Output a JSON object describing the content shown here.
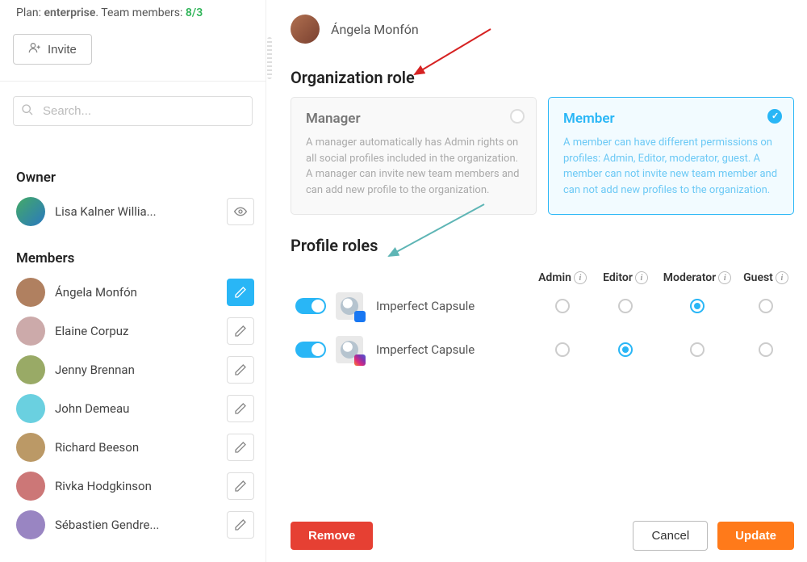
{
  "sidebar": {
    "plan_label": "Plan:",
    "plan_name": "enterprise",
    "members_label": "Team members:",
    "members_count": "8/3",
    "invite_label": "Invite",
    "search_placeholder": "Search...",
    "owner_label": "Owner",
    "members_label_section": "Members",
    "owner": {
      "name": "Lisa Kalner Willia..."
    },
    "members": [
      {
        "name": "Ángela Monfón",
        "editing": true
      },
      {
        "name": "Elaine Corpuz",
        "editing": false
      },
      {
        "name": "Jenny Brennan",
        "editing": false
      },
      {
        "name": "John Demeau",
        "editing": false
      },
      {
        "name": "Richard Beeson",
        "editing": false
      },
      {
        "name": "Rivka Hodgkinson",
        "editing": false
      },
      {
        "name": "Sébastien Gendre...",
        "editing": false
      }
    ]
  },
  "main": {
    "user_name": "Ángela Monfón",
    "org_role_title": "Organization role",
    "roles": {
      "manager": {
        "name": "Manager",
        "desc": "A manager automatically has Admin rights on all social profiles included in the organization. A manager can invite new team members and can add new profile to the organization."
      },
      "member": {
        "name": "Member",
        "desc": "A member can have different permissions on profiles: Admin, Editor, moderator, guest. A member can not invite new team member and can not add new profiles to the organization."
      }
    },
    "selected_role": "member",
    "profile_roles_title": "Profile roles",
    "columns": {
      "admin": "Admin",
      "editor": "Editor",
      "moderator": "Moderator",
      "guest": "Guest"
    },
    "profiles": [
      {
        "name": "Imperfect Capsule",
        "network": "facebook",
        "enabled": true,
        "role": "moderator"
      },
      {
        "name": "Imperfect Capsule",
        "network": "instagram",
        "enabled": true,
        "role": "editor"
      }
    ],
    "buttons": {
      "remove": "Remove",
      "cancel": "Cancel",
      "update": "Update"
    }
  },
  "avatar_colors": [
    "#b08060",
    "#caa",
    "#9a6",
    "#6ad0e0",
    "#b96",
    "#c77",
    "#9985c2",
    "#888"
  ]
}
